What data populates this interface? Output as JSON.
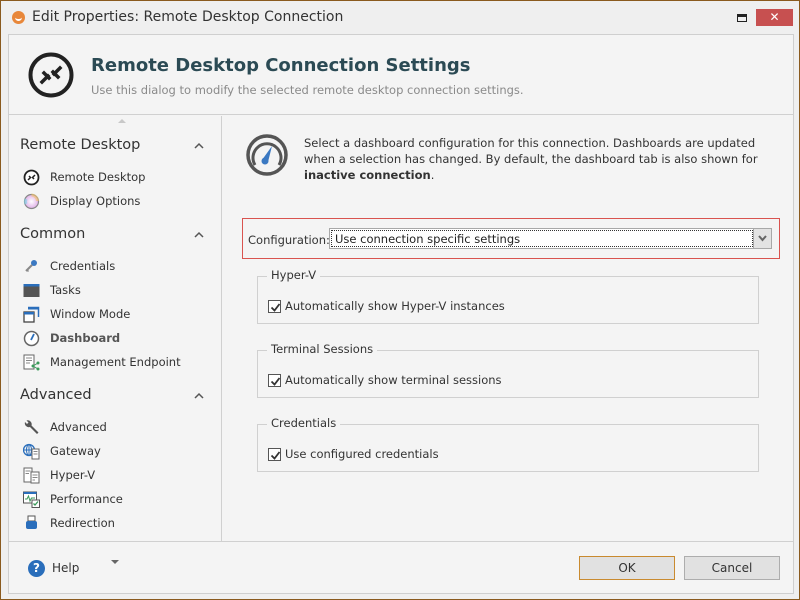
{
  "window": {
    "title": "Edit Properties: Remote Desktop Connection",
    "close_glyph": "✕"
  },
  "header": {
    "title": "Remote Desktop Connection Settings",
    "subtitle": "Use this dialog to modify the selected remote desktop connection settings."
  },
  "sidebar": {
    "groups": [
      {
        "label": "Remote Desktop",
        "items": [
          {
            "label": "Remote Desktop",
            "icon": "remote-desktop-icon"
          },
          {
            "label": "Display Options",
            "icon": "color-wheel-icon"
          }
        ]
      },
      {
        "label": "Common",
        "items": [
          {
            "label": "Credentials",
            "icon": "key-icon"
          },
          {
            "label": "Tasks",
            "icon": "tasks-icon"
          },
          {
            "label": "Window Mode",
            "icon": "window-icon"
          },
          {
            "label": "Dashboard",
            "icon": "gauge-icon",
            "active": true
          },
          {
            "label": "Management Endpoint",
            "icon": "endpoint-icon"
          }
        ]
      },
      {
        "label": "Advanced",
        "items": [
          {
            "label": "Advanced",
            "icon": "wrench-icon"
          },
          {
            "label": "Gateway",
            "icon": "gateway-icon"
          },
          {
            "label": "Hyper-V",
            "icon": "server-icon"
          },
          {
            "label": "Performance",
            "icon": "performance-icon"
          },
          {
            "label": "Redirection",
            "icon": "usb-icon"
          }
        ]
      }
    ]
  },
  "panel": {
    "description_part1": "Select a dashboard configuration for this connection. Dashboards are updated when a selection has changed. By default, the dashboard tab is also shown for ",
    "description_bold": "inactive connection",
    "description_end": ".",
    "config_label": "Configuration:",
    "config_value": "Use connection specific settings",
    "groups": [
      {
        "title": "Hyper-V",
        "checkbox_label": "Automatically show Hyper-V instances",
        "checked": true
      },
      {
        "title": "Terminal Sessions",
        "checkbox_label": "Automatically show terminal sessions",
        "checked": true
      },
      {
        "title": "Credentials",
        "checkbox_label": "Use configured credentials",
        "checked": true
      }
    ]
  },
  "footer": {
    "help_label": "Help",
    "help_glyph": "?",
    "ok_label": "OK",
    "cancel_label": "Cancel"
  },
  "colors": {
    "accent_title": "#2b4a54",
    "highlight_border": "#d9534f",
    "close_button": "#c75050",
    "help_blue": "#2a6ebb",
    "window_border": "#8a5a1e"
  }
}
